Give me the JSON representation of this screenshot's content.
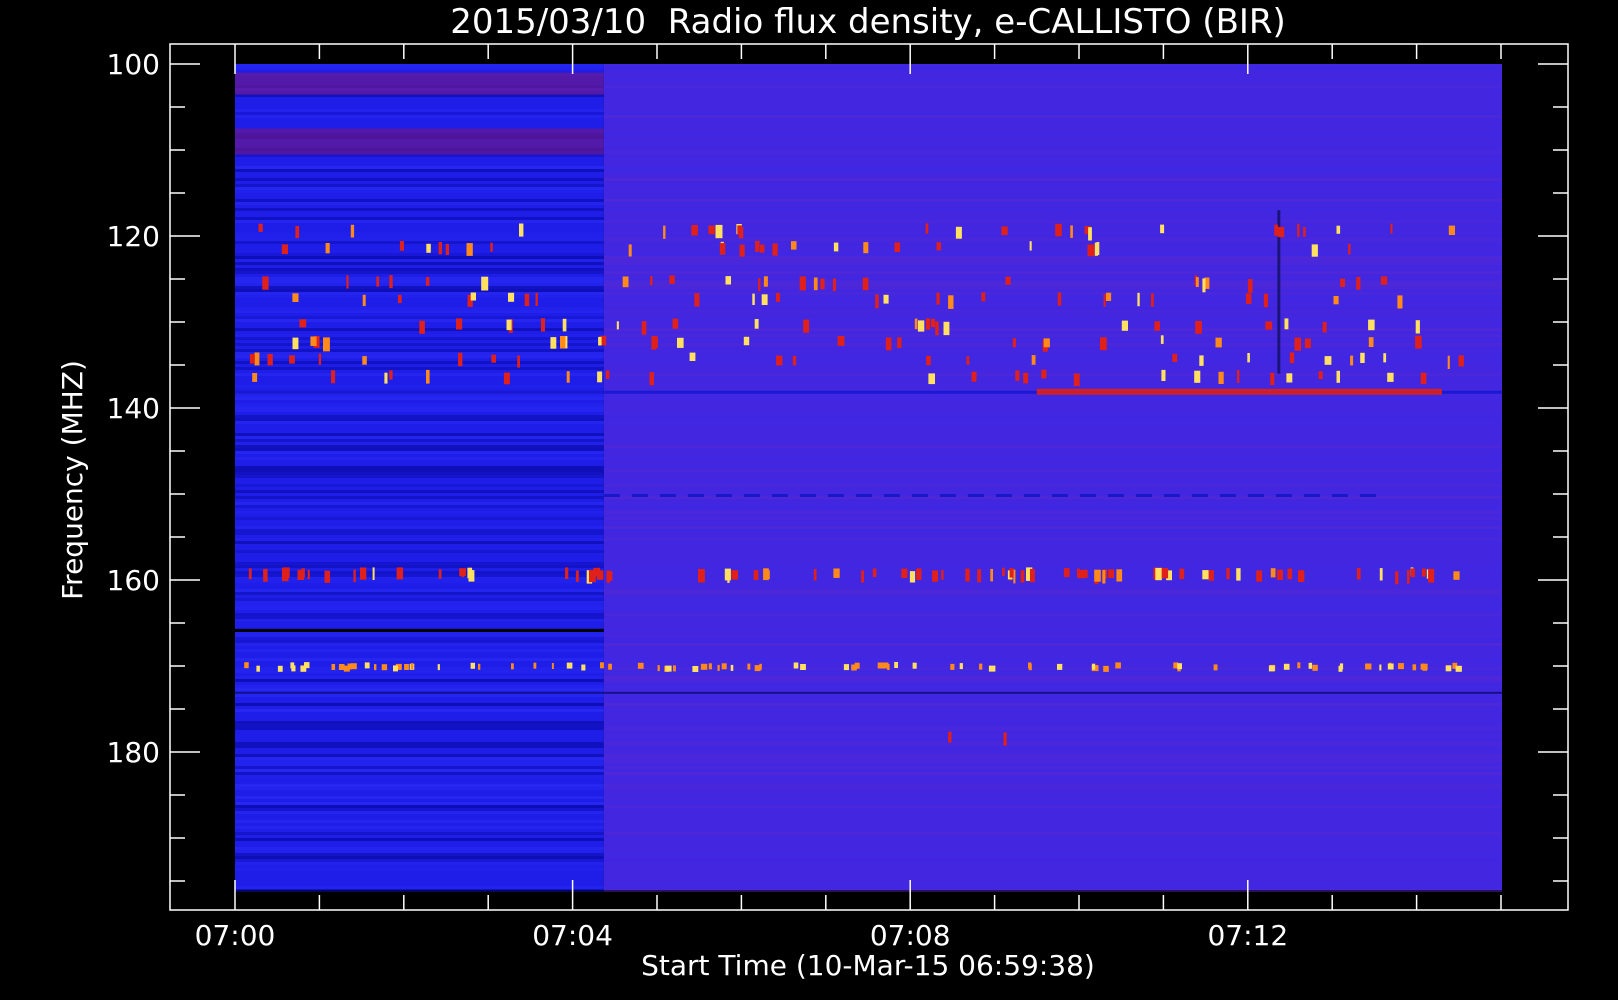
{
  "chart_data": {
    "type": "heatmap",
    "title": "2015/03/10  Radio flux density, e-CALLISTO (BIR)",
    "xlabel": "Start Time (10-Mar-15 06:59:38)",
    "ylabel": "Frequency (MHZ)",
    "x_ticks": [
      "07:00",
      "07:04",
      "07:08",
      "07:12"
    ],
    "y_ticks": [
      "100",
      "120",
      "140",
      "160",
      "180"
    ],
    "ylim": [
      100,
      196
    ],
    "y_reversed": true,
    "xlim_minutes_after_0700": [
      0,
      15
    ],
    "background_change_minute": 4.37,
    "colors": {
      "background": "#000000",
      "axes": "#ffffff",
      "early_segment": "#1e1ee8",
      "late_segment": "#4326e0",
      "burst_red": "#e0201a",
      "burst_orange": "#ff8a1a",
      "burst_yellow": "#ffe060"
    },
    "features": {
      "interference_rows_mhz": [
        119,
        121,
        125,
        127,
        130,
        132,
        134,
        136,
        159,
        170,
        178
      ],
      "persistent_line_mhz": 138,
      "dark_line_early_mhz": 165.7
    }
  }
}
